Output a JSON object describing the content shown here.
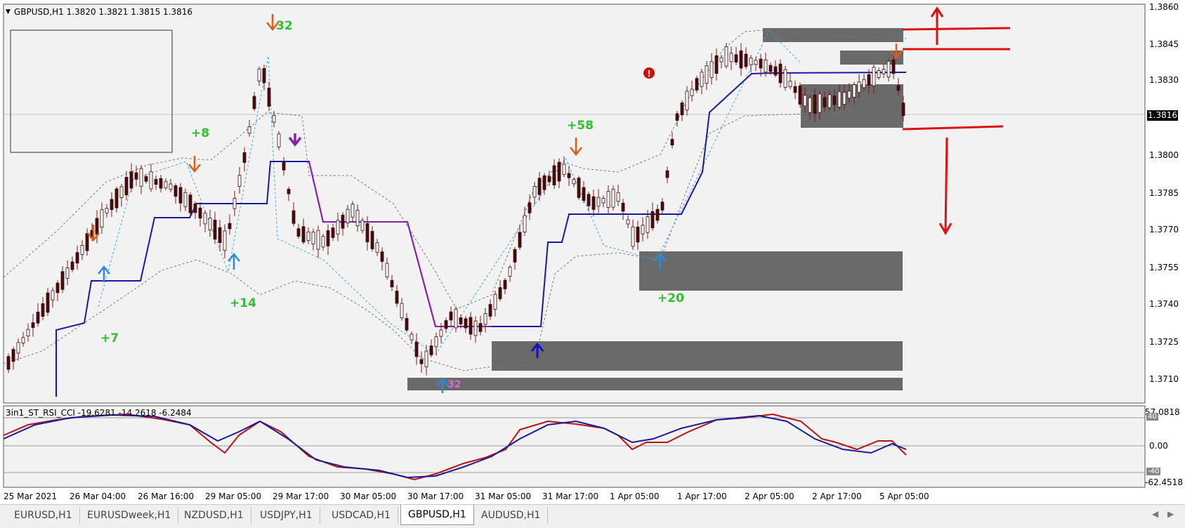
{
  "symbol_header": "GBPUSD,H1  1.3820 1.3821 1.3815 1.3816",
  "indicator_header": "3in1_ST_RSI_CCI -19.6281 -14.2618 -6.2484",
  "current_price": "1.3816",
  "price_axis": [
    "1.3860",
    "1.3845",
    "1.3830",
    "1.3800",
    "1.3785",
    "1.3770",
    "1.3755",
    "1.3740",
    "1.3725",
    "1.3710"
  ],
  "indicator_axis": [
    "57.0818",
    "40",
    "0.00",
    "-40",
    "-62.4518"
  ],
  "time_axis": [
    "25 Mar 2021",
    "26 Mar 04:00",
    "26 Mar 16:00",
    "29 Mar 05:00",
    "29 Mar 17:00",
    "30 Mar 05:00",
    "30 Mar 17:00",
    "31 Mar 05:00",
    "31 Mar 17:00",
    "1 Apr 05:00",
    "1 Apr 17:00",
    "2 Apr 05:00",
    "2 Apr 17:00",
    "5 Apr 05:00"
  ],
  "annotations": [
    "32",
    "+8",
    "+14",
    "+7",
    "+58",
    "+20",
    "32"
  ],
  "tabs": [
    {
      "label": "EURUSD,H1",
      "active": false
    },
    {
      "label": "EURUSDweek,H1",
      "active": false
    },
    {
      "label": "NZDUSD,H1",
      "active": false
    },
    {
      "label": "USDJPY,H1",
      "active": false
    },
    {
      "label": "USDCAD,H1",
      "active": false
    },
    {
      "label": "GBPUSD,H1",
      "active": true
    },
    {
      "label": "AUDUSD,H1",
      "active": false
    }
  ],
  "colors": {
    "bull_candle": "#ffffff",
    "bear_candle": "#4a0b0b",
    "wick": "#7a1a1a",
    "supertrend_line": "#1a1aa0",
    "purple_line": "#8a20a8",
    "zone": "#6a6a6a",
    "signal_up": "#2a8ae0",
    "signal_down": "#e05a1a",
    "annotation": "#2fbf2f",
    "drawing_red": "#e01010",
    "rsi_line": "#c01010",
    "cci_line": "#1a1aa0"
  },
  "icons": [
    "scroll-left-icon",
    "scroll-right-icon",
    "dropdown-triangle-icon"
  ]
}
